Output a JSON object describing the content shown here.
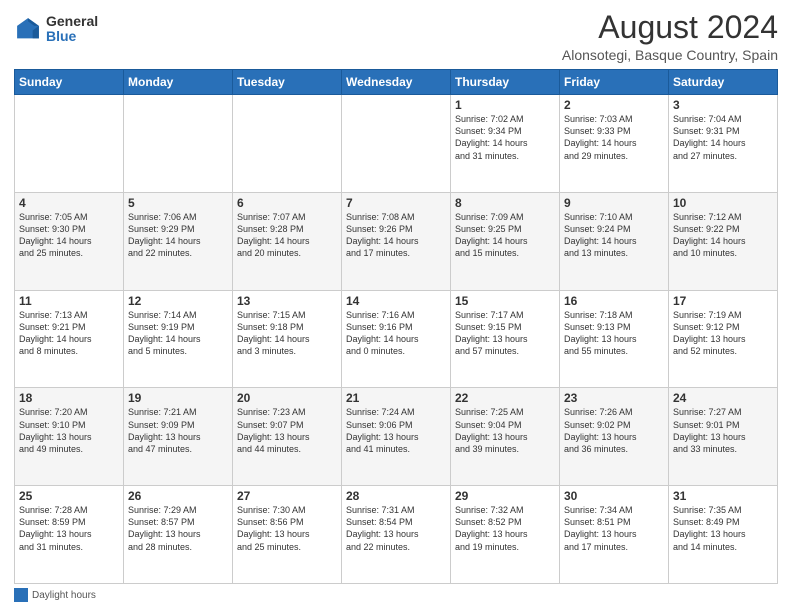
{
  "header": {
    "logo_general": "General",
    "logo_blue": "Blue",
    "title": "August 2024",
    "subtitle": "Alonsotegi, Basque Country, Spain"
  },
  "weekdays": [
    "Sunday",
    "Monday",
    "Tuesday",
    "Wednesday",
    "Thursday",
    "Friday",
    "Saturday"
  ],
  "weeks": [
    [
      {
        "day": "",
        "info": ""
      },
      {
        "day": "",
        "info": ""
      },
      {
        "day": "",
        "info": ""
      },
      {
        "day": "",
        "info": ""
      },
      {
        "day": "1",
        "info": "Sunrise: 7:02 AM\nSunset: 9:34 PM\nDaylight: 14 hours\nand 31 minutes."
      },
      {
        "day": "2",
        "info": "Sunrise: 7:03 AM\nSunset: 9:33 PM\nDaylight: 14 hours\nand 29 minutes."
      },
      {
        "day": "3",
        "info": "Sunrise: 7:04 AM\nSunset: 9:31 PM\nDaylight: 14 hours\nand 27 minutes."
      }
    ],
    [
      {
        "day": "4",
        "info": "Sunrise: 7:05 AM\nSunset: 9:30 PM\nDaylight: 14 hours\nand 25 minutes."
      },
      {
        "day": "5",
        "info": "Sunrise: 7:06 AM\nSunset: 9:29 PM\nDaylight: 14 hours\nand 22 minutes."
      },
      {
        "day": "6",
        "info": "Sunrise: 7:07 AM\nSunset: 9:28 PM\nDaylight: 14 hours\nand 20 minutes."
      },
      {
        "day": "7",
        "info": "Sunrise: 7:08 AM\nSunset: 9:26 PM\nDaylight: 14 hours\nand 17 minutes."
      },
      {
        "day": "8",
        "info": "Sunrise: 7:09 AM\nSunset: 9:25 PM\nDaylight: 14 hours\nand 15 minutes."
      },
      {
        "day": "9",
        "info": "Sunrise: 7:10 AM\nSunset: 9:24 PM\nDaylight: 14 hours\nand 13 minutes."
      },
      {
        "day": "10",
        "info": "Sunrise: 7:12 AM\nSunset: 9:22 PM\nDaylight: 14 hours\nand 10 minutes."
      }
    ],
    [
      {
        "day": "11",
        "info": "Sunrise: 7:13 AM\nSunset: 9:21 PM\nDaylight: 14 hours\nand 8 minutes."
      },
      {
        "day": "12",
        "info": "Sunrise: 7:14 AM\nSunset: 9:19 PM\nDaylight: 14 hours\nand 5 minutes."
      },
      {
        "day": "13",
        "info": "Sunrise: 7:15 AM\nSunset: 9:18 PM\nDaylight: 14 hours\nand 3 minutes."
      },
      {
        "day": "14",
        "info": "Sunrise: 7:16 AM\nSunset: 9:16 PM\nDaylight: 14 hours\nand 0 minutes."
      },
      {
        "day": "15",
        "info": "Sunrise: 7:17 AM\nSunset: 9:15 PM\nDaylight: 13 hours\nand 57 minutes."
      },
      {
        "day": "16",
        "info": "Sunrise: 7:18 AM\nSunset: 9:13 PM\nDaylight: 13 hours\nand 55 minutes."
      },
      {
        "day": "17",
        "info": "Sunrise: 7:19 AM\nSunset: 9:12 PM\nDaylight: 13 hours\nand 52 minutes."
      }
    ],
    [
      {
        "day": "18",
        "info": "Sunrise: 7:20 AM\nSunset: 9:10 PM\nDaylight: 13 hours\nand 49 minutes."
      },
      {
        "day": "19",
        "info": "Sunrise: 7:21 AM\nSunset: 9:09 PM\nDaylight: 13 hours\nand 47 minutes."
      },
      {
        "day": "20",
        "info": "Sunrise: 7:23 AM\nSunset: 9:07 PM\nDaylight: 13 hours\nand 44 minutes."
      },
      {
        "day": "21",
        "info": "Sunrise: 7:24 AM\nSunset: 9:06 PM\nDaylight: 13 hours\nand 41 minutes."
      },
      {
        "day": "22",
        "info": "Sunrise: 7:25 AM\nSunset: 9:04 PM\nDaylight: 13 hours\nand 39 minutes."
      },
      {
        "day": "23",
        "info": "Sunrise: 7:26 AM\nSunset: 9:02 PM\nDaylight: 13 hours\nand 36 minutes."
      },
      {
        "day": "24",
        "info": "Sunrise: 7:27 AM\nSunset: 9:01 PM\nDaylight: 13 hours\nand 33 minutes."
      }
    ],
    [
      {
        "day": "25",
        "info": "Sunrise: 7:28 AM\nSunset: 8:59 PM\nDaylight: 13 hours\nand 31 minutes."
      },
      {
        "day": "26",
        "info": "Sunrise: 7:29 AM\nSunset: 8:57 PM\nDaylight: 13 hours\nand 28 minutes."
      },
      {
        "day": "27",
        "info": "Sunrise: 7:30 AM\nSunset: 8:56 PM\nDaylight: 13 hours\nand 25 minutes."
      },
      {
        "day": "28",
        "info": "Sunrise: 7:31 AM\nSunset: 8:54 PM\nDaylight: 13 hours\nand 22 minutes."
      },
      {
        "day": "29",
        "info": "Sunrise: 7:32 AM\nSunset: 8:52 PM\nDaylight: 13 hours\nand 19 minutes."
      },
      {
        "day": "30",
        "info": "Sunrise: 7:34 AM\nSunset: 8:51 PM\nDaylight: 13 hours\nand 17 minutes."
      },
      {
        "day": "31",
        "info": "Sunrise: 7:35 AM\nSunset: 8:49 PM\nDaylight: 13 hours\nand 14 minutes."
      }
    ]
  ],
  "footer": {
    "legend_label": "Daylight hours"
  }
}
